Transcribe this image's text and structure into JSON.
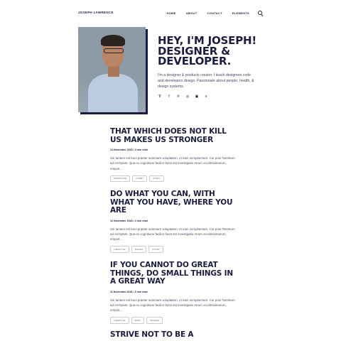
{
  "nav": {
    "logo": "JOSEPH LAWRENCE",
    "items": [
      "HOME",
      "ABOUT",
      "CONTACT",
      "ELEMENTS"
    ]
  },
  "hero": {
    "title": "HEY, I'M JOSEPH! DESIGNER & DEVELOPER.",
    "description": "I'm a designer & products creator. I teach designers code and developers design. Passionate about people, health, & design systems.",
    "social": [
      "twitter-icon",
      "facebook-icon",
      "pinterest-icon",
      "dribbble-icon",
      "instagram-icon",
      "vimeo-icon"
    ]
  },
  "posts": [
    {
      "title": "THAT WHICH DOES NOT KILL US MAKES US STRONGER",
      "meta": "14 November 2018 • 3 min read",
      "excerpt": "Sin tantum est boni praeter summam voluptatem, et eam sempiternam. Cur post Tarentum ad Archytam. Qua ex cognitione facilior facta est investigatio rerum occultissimarum, empuit...",
      "tags": [
        "WORKFLOW",
        "HOBBY",
        "STORY"
      ]
    },
    {
      "title": "DO WHAT YOU CAN, WITH WHAT YOU HAVE, WHERE YOU ARE",
      "meta": "12 November 2018 • 2 min read",
      "excerpt": "Sin tantum est boni praeter summam voluptatem, et eam sempiternam. Cur post Tarentum ad Archytam. Qua ex cognitione facilior facta est investigatio rerum occultissimarum, empuit...",
      "tags": [
        "LIFESTYLE",
        "TRAVEL",
        "STORY"
      ]
    },
    {
      "title": "IF YOU CANNOT DO GREAT THINGS, DO SMALL THINGS IN A GREAT WAY",
      "meta": "11 November 2018 • 3 min read",
      "excerpt": "Sin tantum est boni praeter summam voluptatem, et eam sempiternam. Cur post Tarentum ad Archytam. Qua ex cognitione facilior facta est investigatio rerum occultissimarum, empuit...",
      "tags": [
        "LIFESTYLE",
        "BODY",
        "NATURE"
      ]
    },
    {
      "title": "STRIVE NOT TO BE A"
    }
  ]
}
